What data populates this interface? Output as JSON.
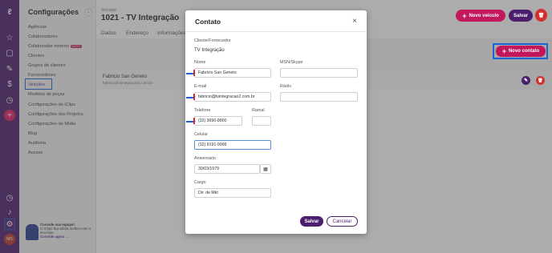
{
  "sidebar": {
    "title": "Configurações",
    "items": [
      "Agências",
      "Colaboradores",
      "Colaborador externo",
      "Clientes",
      "Grupos de clientes",
      "Fornecedores",
      "Veículos",
      "Modelos de peças",
      "Configurações do iClips",
      "Configurações dos Projetos",
      "Configurações de Mídia",
      "Blog",
      "Auditoria",
      "Acesso"
    ],
    "badge": "NOVO",
    "promo_title": "Convide sua equipe!",
    "promo_text": "O iClips fica ainda melhor com o seu time.",
    "promo_link": "Convide agora"
  },
  "header": {
    "breadcrumb": "Veículos",
    "title": "1021 - TV Integração",
    "tabs": [
      "Dados",
      "Endereço",
      "Informações"
    ],
    "new_vehicle": "Novo veículo",
    "save": "Salvar",
    "new_contact": "Novo contato"
  },
  "contact_row": {
    "name": "Fabricio San Geneto",
    "email": "fabricio@tvintegracao2.com.br"
  },
  "modal": {
    "title": "Contato",
    "section": "Cliente/Fornecedor",
    "client": "TV Integração",
    "fields": {
      "nome_label": "Nome",
      "nome": "Fabricio San Geneto",
      "msn_label": "MSN/Skype",
      "msn": "",
      "email_label": "E-mail",
      "email": "fabricio@tvintegracao2.com.br",
      "radio_label": "Rádio",
      "radio": "",
      "telefone_label": "Telefone",
      "telefone": "(32) 3690-8800",
      "ramal_label": "Ramal",
      "ramal": "",
      "celular_label": "Celular",
      "celular": "(32) 9191-9999",
      "aniversario_label": "Aniversário",
      "aniversario": "30/03/1979",
      "cargo_label": "Cargo",
      "cargo": "Dir. de Mkt"
    },
    "save": "Salvar",
    "cancel": "Cancelar"
  },
  "colors": {
    "accent": "#c2185b",
    "rail": "#4b1f6e",
    "highlight": "#1e63d6"
  }
}
